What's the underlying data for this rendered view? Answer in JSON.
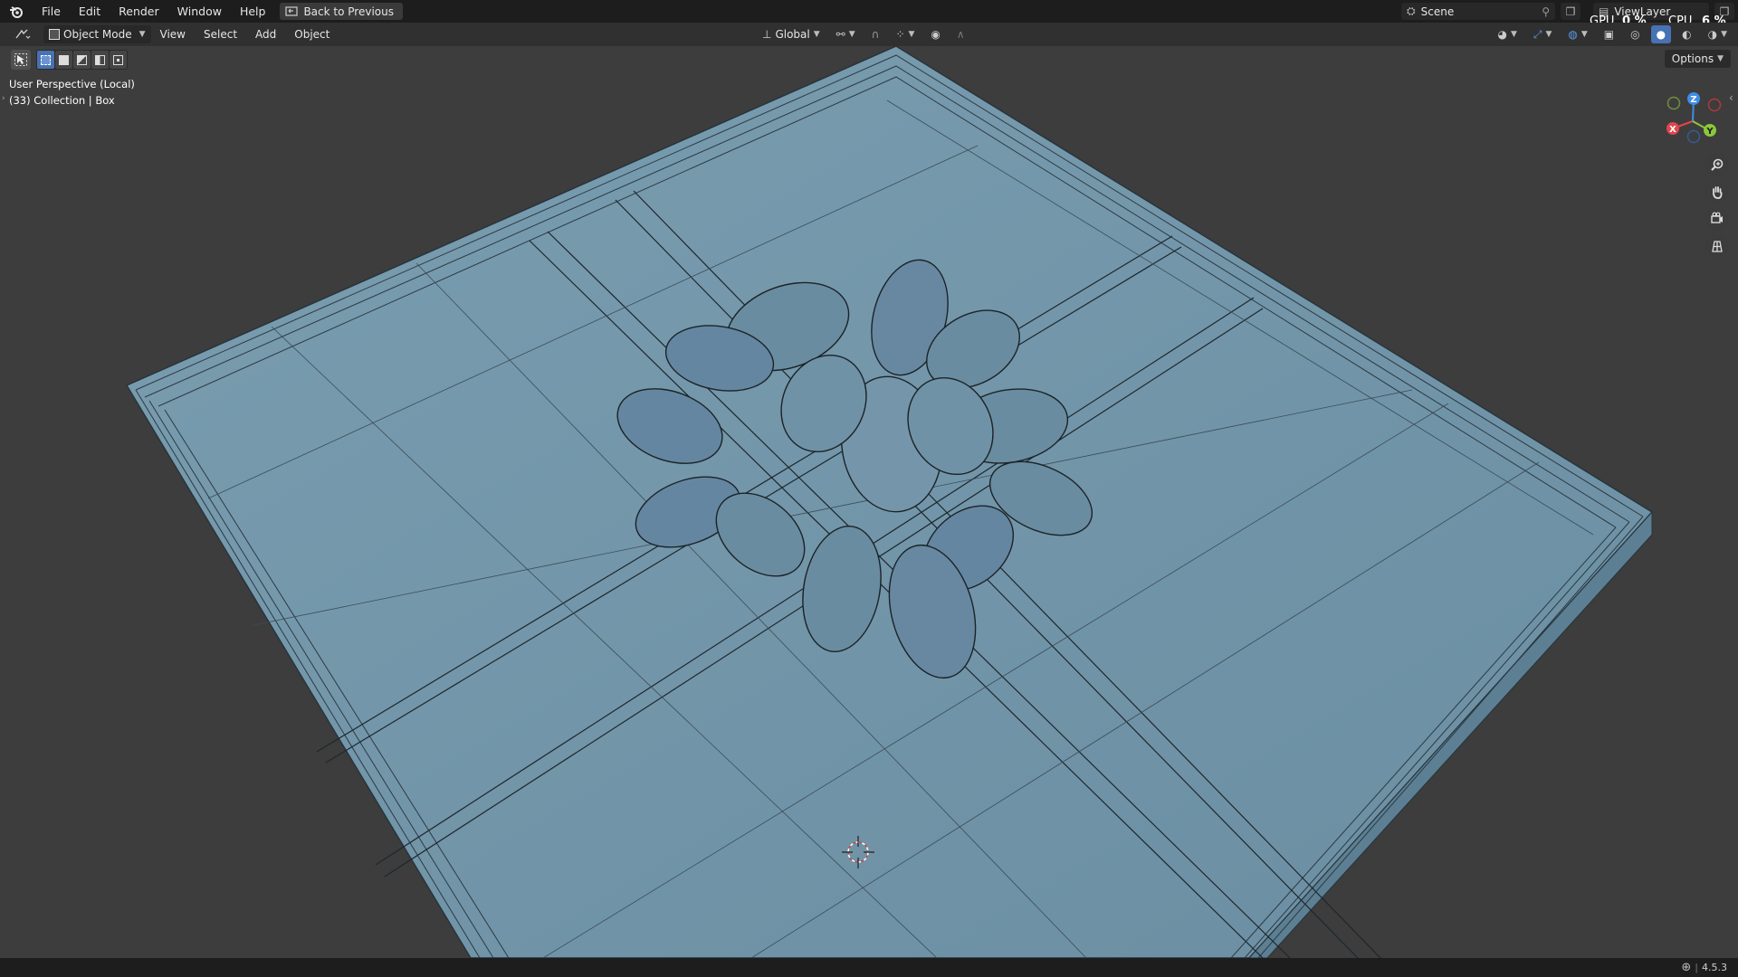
{
  "topbar": {
    "menus": [
      "File",
      "Edit",
      "Render",
      "Window",
      "Help"
    ],
    "back_button": "Back to Previous",
    "scene": "Scene",
    "view_layer": "ViewLayer",
    "gpu_label": "GPU",
    "gpu_value": "0 %",
    "cpu_label": "CPU",
    "cpu_value": "6 %"
  },
  "header": {
    "mode": "Object Mode",
    "menus": [
      "View",
      "Select",
      "Add",
      "Object"
    ],
    "orientation": "Global"
  },
  "viewport": {
    "perspective": "User Perspective (Local)",
    "collection": "(33) Collection | Box",
    "options": "Options",
    "model_color": "#7495a8",
    "gizmo": {
      "x": "X",
      "y": "Y",
      "z": "Z"
    }
  },
  "status": {
    "version": "4.5.3"
  },
  "colors": {
    "accent": "#4772b3",
    "axis_x": "#e0454f",
    "axis_y": "#8bc83a",
    "axis_z": "#3e8ee6"
  }
}
